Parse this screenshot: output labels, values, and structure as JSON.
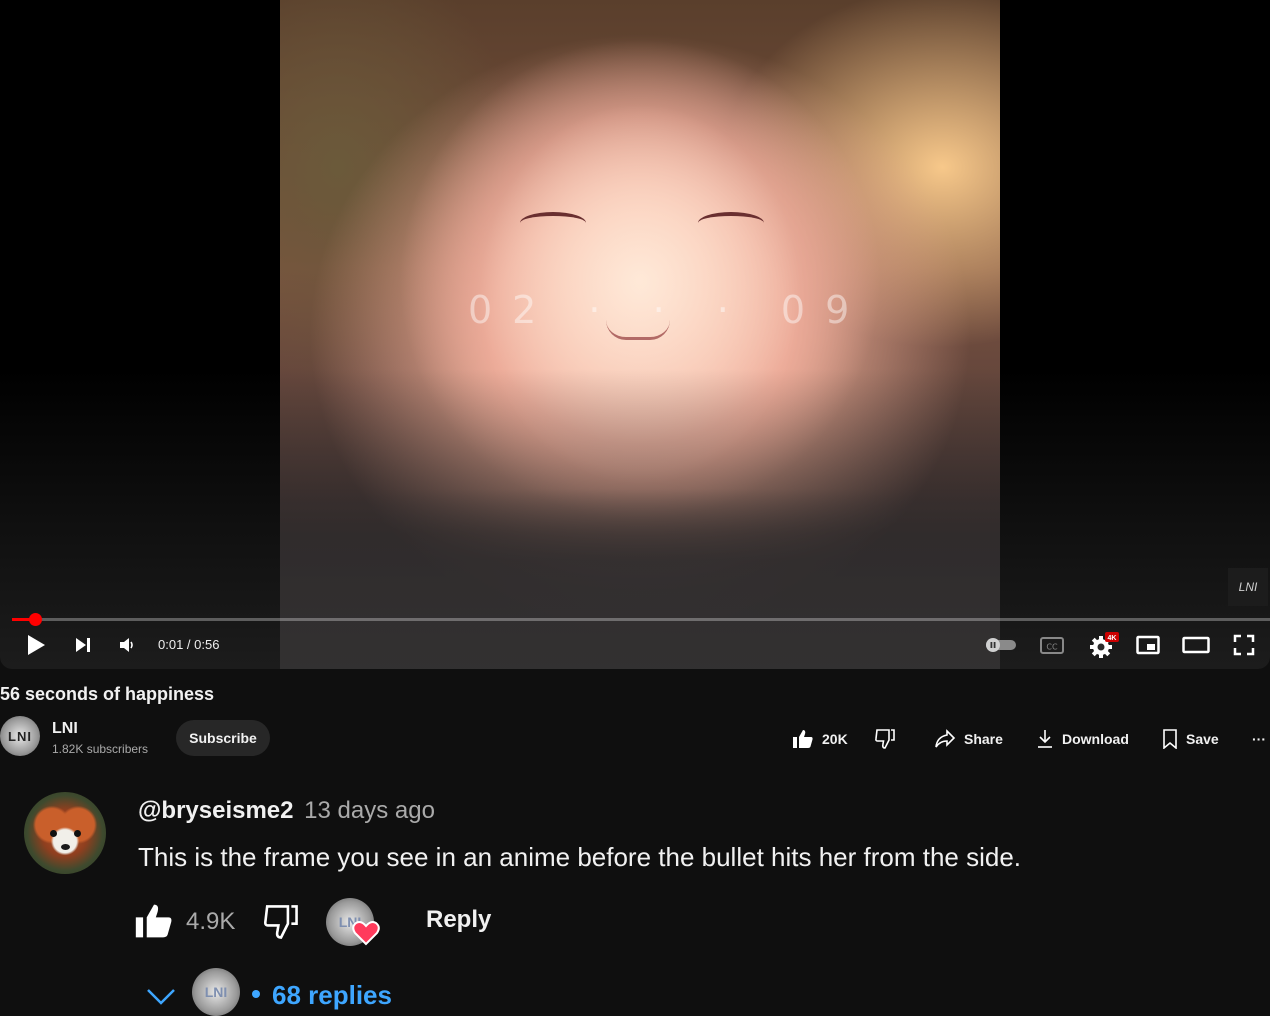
{
  "video": {
    "overlay_text": "02 · · · 09",
    "watermark": "LNI",
    "progress_fraction": 0.018,
    "time_current": "0:01",
    "time_separator": " / ",
    "time_total": "0:56",
    "quality_badge": "4K"
  },
  "icons": {
    "play": "play-icon",
    "next": "next-icon",
    "volume": "volume-icon",
    "autoplay": "autoplay-toggle-icon",
    "captions": "captions-icon",
    "settings": "settings-icon",
    "miniplayer": "miniplayer-icon",
    "theater": "theater-icon",
    "fullscreen": "fullscreen-icon"
  },
  "colors": {
    "accent": "#ff0000",
    "link": "#3ea6ff",
    "heart": "#ff3b5c",
    "background": "#0f0f0f"
  },
  "title": "56 seconds of happiness",
  "channel": {
    "avatar_text": "LNI",
    "name": "LNI",
    "subscribers": "1.82K subscribers",
    "subscribe_label": "Subscribe"
  },
  "actions": {
    "like_count": "20K",
    "share_label": "Share",
    "download_label": "Download",
    "save_label": "Save",
    "more_label": "···"
  },
  "comment": {
    "author": "@bryseisme2",
    "time": "13 days ago",
    "text": "This is the frame you see in an anime before the bullet hits her from the side.",
    "like_count": "4.9K",
    "hearted_by": "LNI",
    "reply_label": "Reply",
    "replies_avatar": "LNI",
    "replies_label": "68 replies"
  }
}
